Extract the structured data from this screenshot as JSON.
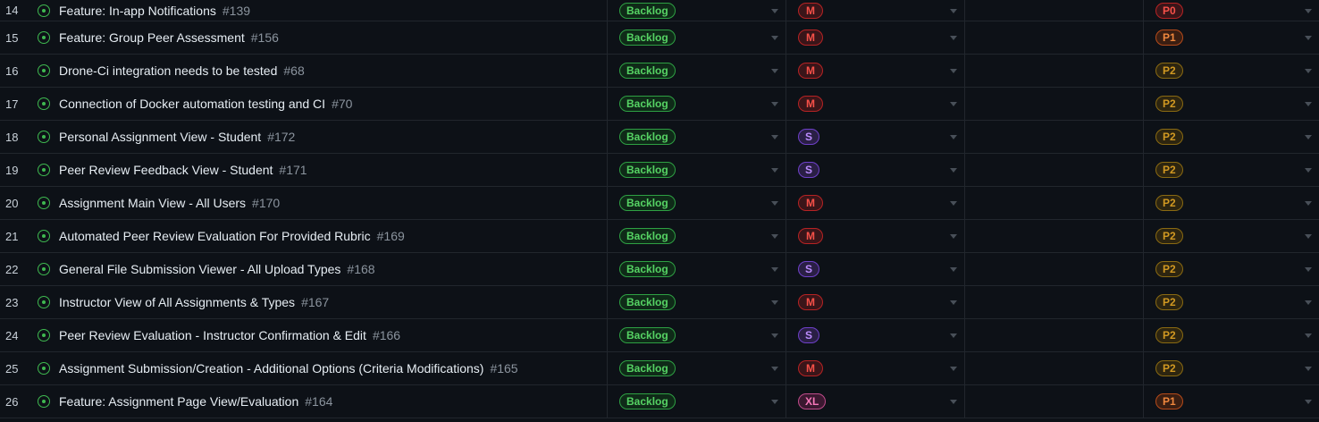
{
  "rows": [
    {
      "num": "14",
      "title": "Feature: In-app Notifications",
      "issue": "#139",
      "status": "Backlog",
      "size": "M",
      "priority": "P0"
    },
    {
      "num": "15",
      "title": "Feature: Group Peer Assessment",
      "issue": "#156",
      "status": "Backlog",
      "size": "M",
      "priority": "P1"
    },
    {
      "num": "16",
      "title": "Drone-Ci integration needs to be tested",
      "issue": "#68",
      "status": "Backlog",
      "size": "M",
      "priority": "P2"
    },
    {
      "num": "17",
      "title": "Connection of Docker automation testing and CI",
      "issue": "#70",
      "status": "Backlog",
      "size": "M",
      "priority": "P2"
    },
    {
      "num": "18",
      "title": "Personal Assignment View - Student",
      "issue": "#172",
      "status": "Backlog",
      "size": "S",
      "priority": "P2"
    },
    {
      "num": "19",
      "title": "Peer Review Feedback View - Student",
      "issue": "#171",
      "status": "Backlog",
      "size": "S",
      "priority": "P2"
    },
    {
      "num": "20",
      "title": "Assignment Main View - All Users",
      "issue": "#170",
      "status": "Backlog",
      "size": "M",
      "priority": "P2"
    },
    {
      "num": "21",
      "title": "Automated Peer Review Evaluation For Provided Rubric",
      "issue": "#169",
      "status": "Backlog",
      "size": "M",
      "priority": "P2"
    },
    {
      "num": "22",
      "title": "General File Submission Viewer - All Upload Types",
      "issue": "#168",
      "status": "Backlog",
      "size": "S",
      "priority": "P2"
    },
    {
      "num": "23",
      "title": "Instructor View of All Assignments & Types",
      "issue": "#167",
      "status": "Backlog",
      "size": "M",
      "priority": "P2"
    },
    {
      "num": "24",
      "title": "Peer Review Evaluation - Instructor Confirmation & Edit",
      "issue": "#166",
      "status": "Backlog",
      "size": "S",
      "priority": "P2"
    },
    {
      "num": "25",
      "title": "Assignment Submission/Creation - Additional Options (Criteria Modifications)",
      "issue": "#165",
      "status": "Backlog",
      "size": "M",
      "priority": "P2"
    },
    {
      "num": "26",
      "title": "Feature: Assignment Page View/Evaluation",
      "issue": "#164",
      "status": "Backlog",
      "size": "XL",
      "priority": "P1"
    }
  ],
  "colors": {
    "background": "#0d1117",
    "border": "#21262d",
    "open_issue": "#3fb950",
    "backlog": "#56d364",
    "size_m": "#f85149",
    "size_s": "#bc8cff",
    "size_xl": "#f778ba",
    "p0": "#f85149",
    "p1": "#f0883e",
    "p2": "#d29922"
  },
  "icons": {
    "issue": "issue-opened-icon",
    "dropdown": "triangle-down-icon"
  }
}
